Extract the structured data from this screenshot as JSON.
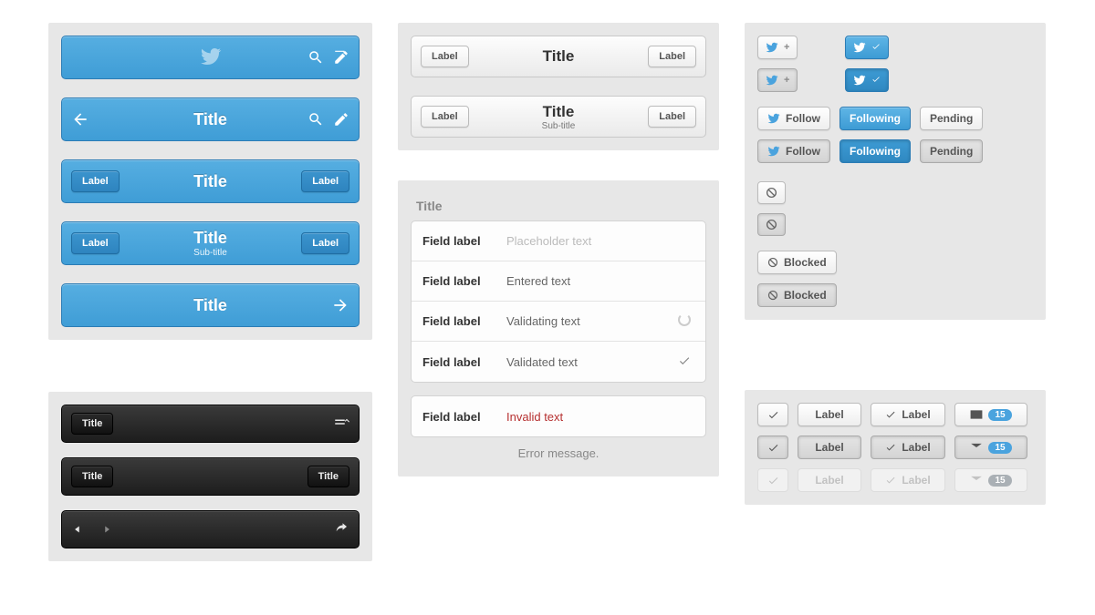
{
  "blue_bars": {
    "bar2": {
      "title": "Title"
    },
    "bar3": {
      "left_label": "Label",
      "title": "Title",
      "right_label": "Label"
    },
    "bar4": {
      "left_label": "Label",
      "title": "Title",
      "subtitle": "Sub-title",
      "right_label": "Label"
    },
    "bar5": {
      "title": "Title"
    }
  },
  "grey_bars": {
    "bar1": {
      "left_label": "Label",
      "title": "Title",
      "right_label": "Label"
    },
    "bar2": {
      "left_label": "Label",
      "title": "Title",
      "subtitle": "Sub-title",
      "right_label": "Label"
    }
  },
  "form": {
    "section_title": "Title",
    "rows": [
      {
        "label": "Field label",
        "value": "Placeholder text"
      },
      {
        "label": "Field label",
        "value": "Entered text"
      },
      {
        "label": "Field label",
        "value": "Validating text"
      },
      {
        "label": "Field label",
        "value": "Validated text"
      }
    ],
    "error_row": {
      "label": "Field label",
      "value": "Invalid text"
    },
    "error_message": "Error message."
  },
  "black_bars": {
    "bar1": {
      "left_label": "Title"
    },
    "bar2": {
      "left_label": "Title",
      "right_label": "Title"
    }
  },
  "follow": {
    "follow": "Follow",
    "following": "Following",
    "pending": "Pending",
    "blocked": "Blocked"
  },
  "labels": {
    "label": "Label",
    "badge_count": "15"
  }
}
